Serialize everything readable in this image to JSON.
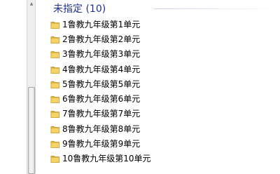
{
  "group": {
    "title": "未指定 (10)"
  },
  "files": [
    {
      "name": "1鲁教九年级第1单元",
      "icon": "folder-icon"
    },
    {
      "name": "2鲁教九年级第2单元",
      "icon": "folder-icon"
    },
    {
      "name": "3鲁教九年级第3单元",
      "icon": "folder-icon"
    },
    {
      "name": "4鲁教九年级第4单元",
      "icon": "folder-icon"
    },
    {
      "name": "5鲁教九年级第5单元",
      "icon": "folder-icon"
    },
    {
      "name": "6鲁教九年级第6单元",
      "icon": "folder-icon"
    },
    {
      "name": "7鲁教九年级第7单元",
      "icon": "folder-icon"
    },
    {
      "name": "8鲁教九年级第8单元",
      "icon": "folder-icon"
    },
    {
      "name": "9鲁教九年级第9单元",
      "icon": "folder-icon"
    },
    {
      "name": "10鲁教九年级第10单元",
      "icon": "folder-icon"
    }
  ],
  "colors": {
    "group_header": "#1e3287",
    "folder_fill": "#f3c94e",
    "folder_stroke": "#c99a1a"
  }
}
